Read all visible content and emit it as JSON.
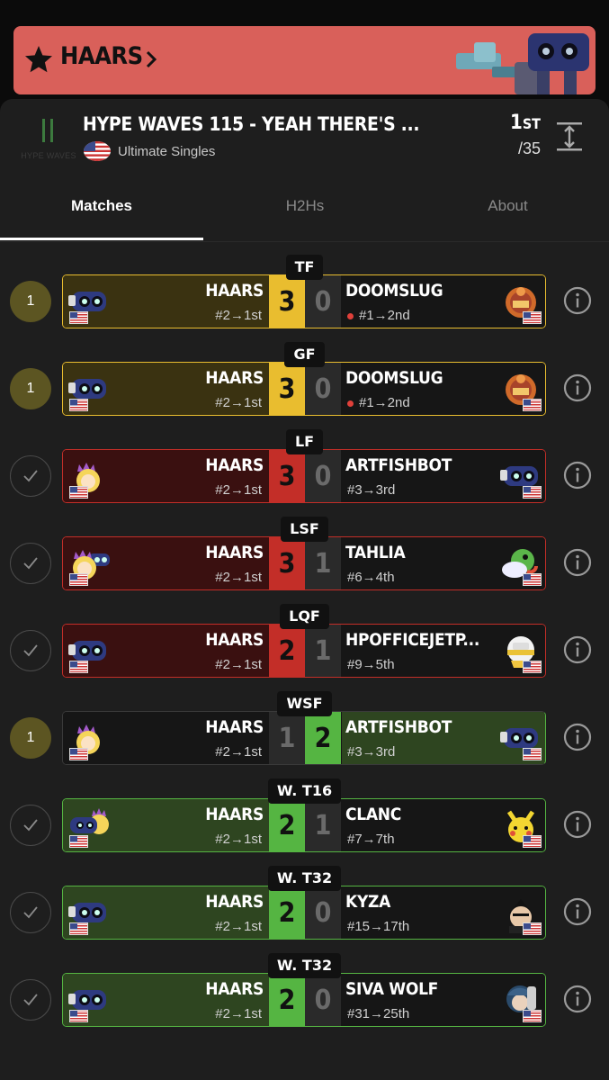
{
  "header": {
    "player_name": "HAARS"
  },
  "tournament": {
    "logo_text": "HYPE WAVES",
    "title": "HYPE WAVES 115 - YEAH THERE'S ...",
    "event": "Ultimate Singles",
    "placing": "1",
    "placing_suffix": "ST",
    "entrants": "/35"
  },
  "tabs": [
    {
      "label": "Matches",
      "active": true
    },
    {
      "label": "H2Hs",
      "active": false
    },
    {
      "label": "About",
      "active": false
    }
  ],
  "colors": {
    "win": "#55b542",
    "loss": "#c32e28",
    "pending": "#e9bd2f",
    "win_bg": "#2e4520",
    "loss_bg": "#3a1010",
    "pending_bg": "#3a3211"
  },
  "matches": [
    {
      "round": "TF",
      "status": "1",
      "style": "pending",
      "p1": {
        "name": "HAARS",
        "seed": "#2→1st",
        "char": "rob-icon"
      },
      "p2": {
        "name": "DOOMSLUG",
        "seed": "#1→2nd",
        "char": "samus-icon",
        "dot": true
      },
      "s1": "3",
      "s2": "0"
    },
    {
      "round": "GF",
      "status": "1",
      "style": "pending",
      "p1": {
        "name": "HAARS",
        "seed": "#2→1st",
        "char": "rob-icon"
      },
      "p2": {
        "name": "DOOMSLUG",
        "seed": "#1→2nd",
        "char": "samus-icon",
        "dot": true
      },
      "s1": "3",
      "s2": "0"
    },
    {
      "round": "LF",
      "status": "check",
      "style": "loss",
      "p1": {
        "name": "HAARS",
        "seed": "#2→1st",
        "char": "peach-icon"
      },
      "p2": {
        "name": "ARTFISHBOT",
        "seed": "#3→3rd",
        "char": "rob-icon",
        "dot": false
      },
      "s1": "3",
      "s2": "0"
    },
    {
      "round": "LSF",
      "status": "check",
      "style": "loss",
      "p1": {
        "name": "HAARS",
        "seed": "#2→1st",
        "char": "peach-rob-icon"
      },
      "p2": {
        "name": "TAHLIA",
        "seed": "#6→4th",
        "char": "yoshi-icon",
        "dot": false
      },
      "s1": "3",
      "s2": "1"
    },
    {
      "round": "LQF",
      "status": "check",
      "style": "loss",
      "p1": {
        "name": "HAARS",
        "seed": "#2→1st",
        "char": "rob-icon"
      },
      "p2": {
        "name": "HPOFFICEJETP...",
        "seed": "#9→5th",
        "char": "min-min-icon",
        "dot": false
      },
      "s1": "2",
      "s2": "1"
    },
    {
      "round": "WSF",
      "status": "1",
      "style": "winright",
      "p1": {
        "name": "HAARS",
        "seed": "#2→1st",
        "char": "peach-icon"
      },
      "p2": {
        "name": "ARTFISHBOT",
        "seed": "#3→3rd",
        "char": "rob-icon",
        "dot": false
      },
      "s1": "1",
      "s2": "2"
    },
    {
      "round": "W. T16",
      "status": "check",
      "style": "win",
      "p1": {
        "name": "HAARS",
        "seed": "#2→1st",
        "char": "rob-peach-icon"
      },
      "p2": {
        "name": "CLANC",
        "seed": "#7→7th",
        "char": "pikachu-icon",
        "dot": false
      },
      "s1": "2",
      "s2": "1"
    },
    {
      "round": "W. T32",
      "status": "check",
      "style": "win",
      "p1": {
        "name": "HAARS",
        "seed": "#2→1st",
        "char": "rob-icon"
      },
      "p2": {
        "name": "KYZA",
        "seed": "#15→17th",
        "char": "kazuya-icon",
        "dot": false
      },
      "s1": "2",
      "s2": "0"
    },
    {
      "round": "W. T32",
      "status": "check",
      "style": "win",
      "p1": {
        "name": "HAARS",
        "seed": "#2→1st",
        "char": "rob-icon"
      },
      "p2": {
        "name": "SIVA WOLF",
        "seed": "#31→25th",
        "char": "byleth-icon",
        "dot": false
      },
      "s1": "2",
      "s2": "0"
    }
  ]
}
